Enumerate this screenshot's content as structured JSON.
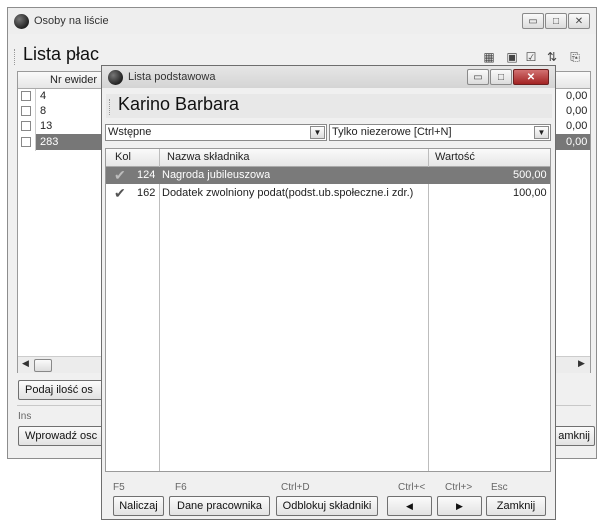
{
  "back_window": {
    "title": "Osoby na liście",
    "heading": "Lista płac",
    "column_nr": "Nr ewider",
    "rows": [
      {
        "nr": "4",
        "value": "0,00",
        "selected": false
      },
      {
        "nr": "8",
        "value": "0,00",
        "selected": false
      },
      {
        "nr": "13",
        "value": "0,00",
        "selected": false
      },
      {
        "nr": "283",
        "value": "0,00",
        "selected": true
      }
    ],
    "podaj_button": "Podaj ilość os",
    "ins_key": "Ins",
    "wprowadz_button": "Wprowadź osc",
    "zamknij_button": "amknij"
  },
  "dialog": {
    "title": "Lista podstawowa",
    "heading": "Karino Barbara",
    "filter_left": "Wstępne",
    "filter_right": "Tylko niezerowe [Ctrl+N]",
    "columns": {
      "kol": "Kol",
      "nazwa": "Nazwa składnika",
      "wartosc": "Wartość"
    },
    "rows": [
      {
        "kol": "124",
        "nazwa": "Nagroda jubileuszowa",
        "wartosc": "500,00",
        "selected": true
      },
      {
        "kol": "162",
        "nazwa": "Dodatek zwolniony podat(podst.ub.społeczne.i zdr.)",
        "wartosc": "100,00",
        "selected": false
      }
    ],
    "buttons": {
      "naliczaj": {
        "key": "F5",
        "label": "Naliczaj"
      },
      "dane": {
        "key": "F6",
        "label": "Dane pracownika"
      },
      "odblokuj": {
        "key": "Ctrl+D",
        "label": "Odblokuj składniki"
      },
      "prev": {
        "key": "Ctrl+<",
        "label": "◀"
      },
      "next": {
        "key": "Ctrl+>",
        "label": "▶"
      },
      "zamknij": {
        "key": "Esc",
        "label": "Zamknij"
      }
    }
  }
}
